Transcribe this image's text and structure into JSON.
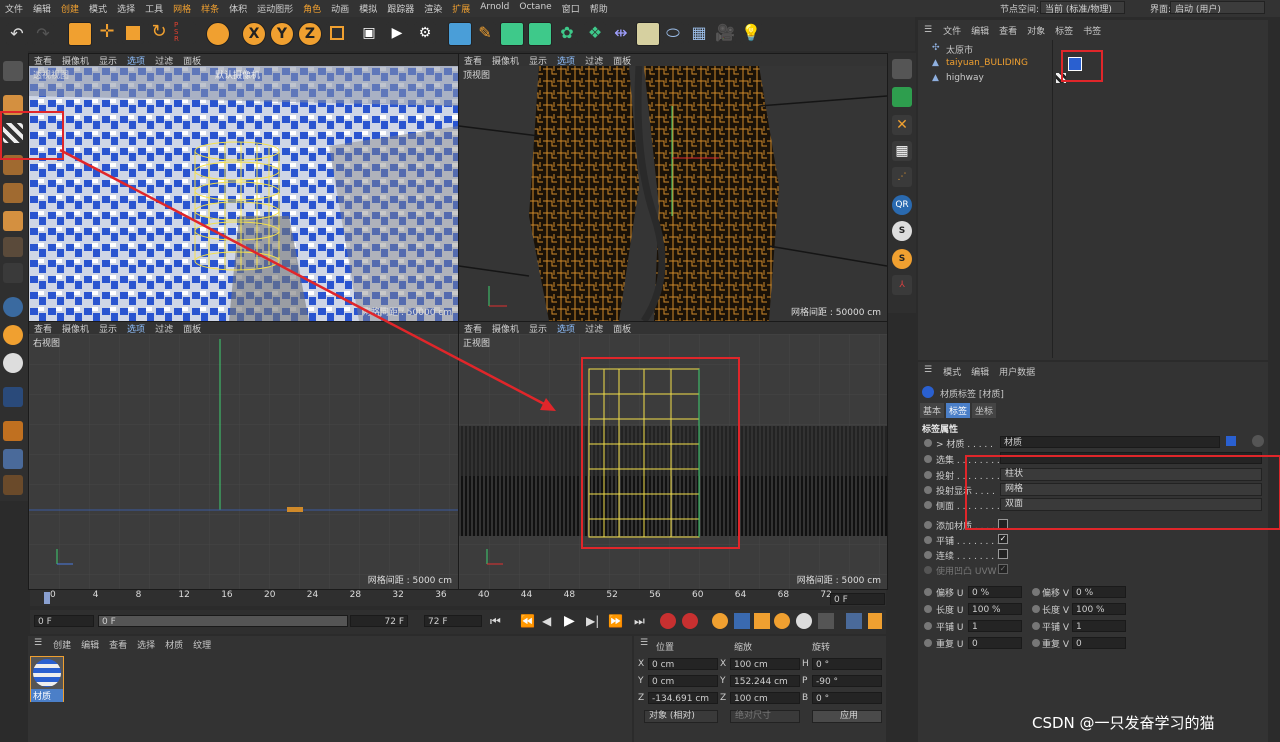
{
  "menubar": {
    "items": [
      "文件",
      "编辑",
      "创建",
      "模式",
      "选择",
      "工具",
      "网格",
      "样条",
      "体积",
      "运动图形",
      "角色",
      "动画",
      "模拟",
      "跟踪器",
      "渲染",
      "扩展",
      "Arnold",
      "Octane",
      "窗口",
      "帮助"
    ],
    "highlight": [
      "创建",
      "网格",
      "样条",
      "角色",
      "扩展"
    ],
    "node_space_label": "节点空间:",
    "node_space_value": "当前 (标准/物理)",
    "interface_label": "界面:",
    "interface_value": "启动 (用户)"
  },
  "viewports": {
    "menu": [
      "查看",
      "摄像机",
      "显示",
      "选项",
      "过滤",
      "面板"
    ],
    "perspective": {
      "label": "透视视图",
      "camera": "默认摄像机",
      "grid": "网格间距 : 50000 cm"
    },
    "top": {
      "label": "顶视图",
      "grid": "网格间距 : 50000 cm"
    },
    "right": {
      "label": "右视图",
      "grid": "网格间距 : 5000 cm"
    },
    "front": {
      "label": "正视图",
      "grid": "网格间距 : 5000 cm"
    }
  },
  "object_manager": {
    "menu": [
      "文件",
      "编辑",
      "查看",
      "对象",
      "标签",
      "书签"
    ],
    "objects": [
      {
        "name": "太原市"
      },
      {
        "name": "taiyuan_BULIDING"
      },
      {
        "name": "highway"
      }
    ]
  },
  "attributes": {
    "menu": [
      "模式",
      "编辑",
      "用户数据"
    ],
    "title": "材质标签 [材质]",
    "tabs": [
      "基本",
      "标签",
      "坐标"
    ],
    "section": "标签属性",
    "rows": [
      {
        "label": "> 材质 . . . . .",
        "value": "材质"
      },
      {
        "label": "选集 . . . . . . . .",
        "value": ""
      },
      {
        "label": "投射 . . . . . . . .",
        "value": "柱状"
      },
      {
        "label": "投射显示 . . . .",
        "value": "网格"
      },
      {
        "label": "侧面 . . . . . . . .",
        "value": "双面"
      }
    ],
    "checks": [
      {
        "label": "添加材质 . . . .",
        "checked": false
      },
      {
        "label": "平铺 . . . . . . . .",
        "checked": true
      },
      {
        "label": "连续 . . . . . . . .",
        "checked": false
      },
      {
        "label": "使用凹凸 UVW",
        "checked": true
      }
    ],
    "uv": [
      {
        "l": "偏移 U",
        "v": "0 %",
        "l2": "偏移 V",
        "v2": "0 %"
      },
      {
        "l": "长度 U",
        "v": "100 %",
        "l2": "长度 V",
        "v2": "100 %"
      },
      {
        "l": "平铺 U",
        "v": "1",
        "l2": "平铺 V",
        "v2": "1"
      },
      {
        "l": "重复 U",
        "v": "0",
        "l2": "重复 V",
        "v2": "0"
      }
    ]
  },
  "timeline": {
    "ticks": [
      "0",
      "4",
      "8",
      "12",
      "16",
      "20",
      "24",
      "28",
      "32",
      "36",
      "40",
      "44",
      "48",
      "52",
      "56",
      "60",
      "64",
      "68",
      "72"
    ],
    "current_frame": "0 F",
    "start_frame": "0 F",
    "start_frame2": "0 F",
    "end_frame": "72 F",
    "end_frame2": "72 F"
  },
  "material_manager": {
    "menu": [
      "创建",
      "编辑",
      "查看",
      "选择",
      "材质",
      "纹理"
    ],
    "material_name": "材质"
  },
  "coordinates": {
    "headers": [
      "位置",
      "缩放",
      "旋转"
    ],
    "rows": [
      {
        "a": "X",
        "av": "0 cm",
        "b": "X",
        "bv": "100 cm",
        "c": "H",
        "cv": "0 °"
      },
      {
        "a": "Y",
        "av": "0 cm",
        "b": "Y",
        "bv": "152.244 cm",
        "c": "P",
        "cv": "-90 °"
      },
      {
        "a": "Z",
        "av": "-134.691 cm",
        "b": "Z",
        "bv": "100 cm",
        "c": "B",
        "cv": "0 °"
      }
    ],
    "mode": "对象 (相对)",
    "size_mode": "绝对尺寸",
    "apply": "应用"
  },
  "watermark": "CSDN @一只发奋学习的猫",
  "colors": {
    "accent": "#f0a030",
    "selection": "#4b7fc8",
    "annotation": "#e0262a",
    "grid_orange": "#d08a2a"
  }
}
